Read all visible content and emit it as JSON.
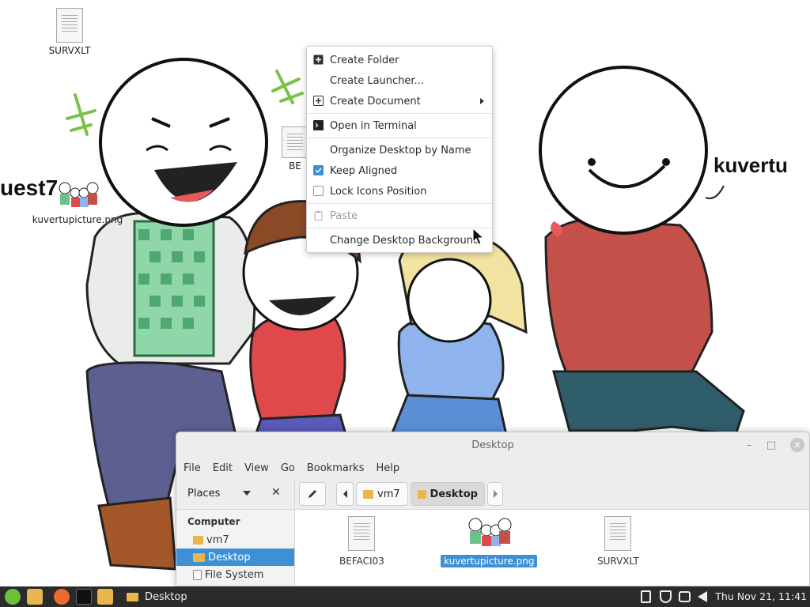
{
  "wallpaper": {
    "texts": {
      "left_name": "uest7",
      "right_name": "kuvertu"
    }
  },
  "desktop_icons": [
    {
      "label": "SURVXLT"
    },
    {
      "label": "kuvertupicture.png"
    },
    {
      "label": "BE"
    }
  ],
  "context_menu": {
    "items": [
      {
        "label": "Create Folder",
        "icon": "plus-folder-icon",
        "disabled": false
      },
      {
        "label": "Create Launcher...",
        "icon": "",
        "disabled": false
      },
      {
        "label": "Create Document",
        "icon": "plus-document-icon",
        "has_submenu": true,
        "disabled": false
      },
      {
        "label": "Open in Terminal",
        "icon": "terminal-icon",
        "disabled": false
      },
      {
        "label": "Organize Desktop by Name",
        "icon": "",
        "disabled": false
      },
      {
        "label": "Keep Aligned",
        "icon": "checkbox-icon",
        "checked": true,
        "disabled": false
      },
      {
        "label": "Lock Icons Position",
        "icon": "checkbox-icon",
        "checked": false,
        "disabled": false
      },
      {
        "label": "Paste",
        "icon": "clipboard-icon",
        "disabled": true
      },
      {
        "label": "Change Desktop Background",
        "icon": "",
        "disabled": false
      }
    ]
  },
  "file_manager": {
    "title": "Desktop",
    "menu": [
      "File",
      "Edit",
      "View",
      "Go",
      "Bookmarks",
      "Help"
    ],
    "places_label": "Places",
    "breadcrumbs": [
      "vm7",
      "Desktop"
    ],
    "sidebar": {
      "heading": "Computer",
      "items": [
        {
          "label": "vm7",
          "icon": "home-folder-icon",
          "selected": false
        },
        {
          "label": "Desktop",
          "icon": "folder-icon",
          "selected": true
        },
        {
          "label": "File System",
          "icon": "drive-icon",
          "selected": false
        }
      ]
    },
    "files": [
      {
        "name": "BEFACI03",
        "type": "document",
        "selected": false
      },
      {
        "name": "kuvertupicture.png",
        "type": "image",
        "selected": true
      },
      {
        "name": "SURVXLT",
        "type": "document",
        "selected": false
      }
    ]
  },
  "taskbar": {
    "active_window": "Desktop",
    "clock": "Thu Nov 21, 11:41"
  },
  "colors": {
    "accent": "#3d8fd6",
    "taskbar_bg": "#2b2b2b",
    "folder": "#e8b64c"
  }
}
